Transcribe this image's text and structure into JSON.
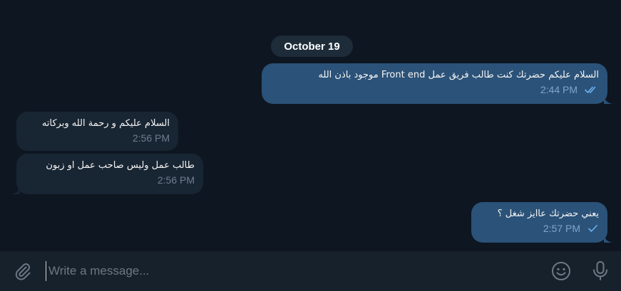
{
  "chat": {
    "date_label": "October 19",
    "messages": [
      {
        "direction": "out",
        "text": "السلام عليكم حضرتك كنت طالب فريق عمل Front end  موجود باذن الله",
        "time": "2:44 PM",
        "status": "read"
      },
      {
        "direction": "in",
        "text": "السلام عليكم و رحمة الله وبركاته",
        "time": "2:56 PM"
      },
      {
        "direction": "in",
        "text": "طالب عمل وليس صاحب عمل او زبون",
        "time": "2:56 PM"
      },
      {
        "direction": "out",
        "text": "يعني حضرتك عاايز شغل ؟",
        "time": "2:57 PM",
        "status": "sent"
      }
    ]
  },
  "composer": {
    "placeholder": "Write a message...",
    "attach_icon": "paperclip-icon",
    "emoji_icon": "emoji-icon",
    "mic_icon": "microphone-icon"
  },
  "colors": {
    "background": "#0e1621",
    "outgoing_bubble": "#2b5278",
    "incoming_bubble": "#182533",
    "composer": "#17212b",
    "check_color": "#6ab3f3"
  }
}
